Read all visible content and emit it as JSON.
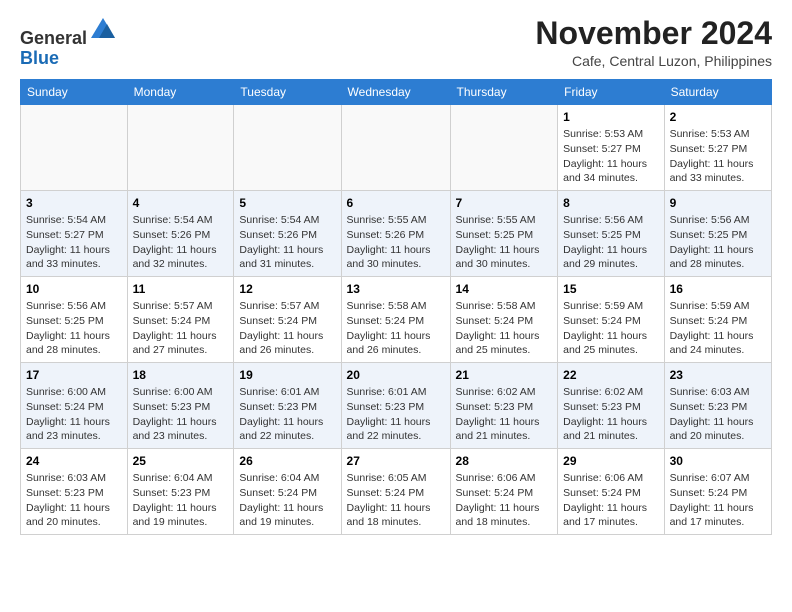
{
  "header": {
    "logo_general": "General",
    "logo_blue": "Blue",
    "month_title": "November 2024",
    "subtitle": "Cafe, Central Luzon, Philippines"
  },
  "days_of_week": [
    "Sunday",
    "Monday",
    "Tuesday",
    "Wednesday",
    "Thursday",
    "Friday",
    "Saturday"
  ],
  "weeks": [
    [
      {
        "day": "",
        "detail": ""
      },
      {
        "day": "",
        "detail": ""
      },
      {
        "day": "",
        "detail": ""
      },
      {
        "day": "",
        "detail": ""
      },
      {
        "day": "",
        "detail": ""
      },
      {
        "day": "1",
        "detail": "Sunrise: 5:53 AM\nSunset: 5:27 PM\nDaylight: 11 hours\nand 34 minutes."
      },
      {
        "day": "2",
        "detail": "Sunrise: 5:53 AM\nSunset: 5:27 PM\nDaylight: 11 hours\nand 33 minutes."
      }
    ],
    [
      {
        "day": "3",
        "detail": "Sunrise: 5:54 AM\nSunset: 5:27 PM\nDaylight: 11 hours\nand 33 minutes."
      },
      {
        "day": "4",
        "detail": "Sunrise: 5:54 AM\nSunset: 5:26 PM\nDaylight: 11 hours\nand 32 minutes."
      },
      {
        "day": "5",
        "detail": "Sunrise: 5:54 AM\nSunset: 5:26 PM\nDaylight: 11 hours\nand 31 minutes."
      },
      {
        "day": "6",
        "detail": "Sunrise: 5:55 AM\nSunset: 5:26 PM\nDaylight: 11 hours\nand 30 minutes."
      },
      {
        "day": "7",
        "detail": "Sunrise: 5:55 AM\nSunset: 5:25 PM\nDaylight: 11 hours\nand 30 minutes."
      },
      {
        "day": "8",
        "detail": "Sunrise: 5:56 AM\nSunset: 5:25 PM\nDaylight: 11 hours\nand 29 minutes."
      },
      {
        "day": "9",
        "detail": "Sunrise: 5:56 AM\nSunset: 5:25 PM\nDaylight: 11 hours\nand 28 minutes."
      }
    ],
    [
      {
        "day": "10",
        "detail": "Sunrise: 5:56 AM\nSunset: 5:25 PM\nDaylight: 11 hours\nand 28 minutes."
      },
      {
        "day": "11",
        "detail": "Sunrise: 5:57 AM\nSunset: 5:24 PM\nDaylight: 11 hours\nand 27 minutes."
      },
      {
        "day": "12",
        "detail": "Sunrise: 5:57 AM\nSunset: 5:24 PM\nDaylight: 11 hours\nand 26 minutes."
      },
      {
        "day": "13",
        "detail": "Sunrise: 5:58 AM\nSunset: 5:24 PM\nDaylight: 11 hours\nand 26 minutes."
      },
      {
        "day": "14",
        "detail": "Sunrise: 5:58 AM\nSunset: 5:24 PM\nDaylight: 11 hours\nand 25 minutes."
      },
      {
        "day": "15",
        "detail": "Sunrise: 5:59 AM\nSunset: 5:24 PM\nDaylight: 11 hours\nand 25 minutes."
      },
      {
        "day": "16",
        "detail": "Sunrise: 5:59 AM\nSunset: 5:24 PM\nDaylight: 11 hours\nand 24 minutes."
      }
    ],
    [
      {
        "day": "17",
        "detail": "Sunrise: 6:00 AM\nSunset: 5:24 PM\nDaylight: 11 hours\nand 23 minutes."
      },
      {
        "day": "18",
        "detail": "Sunrise: 6:00 AM\nSunset: 5:23 PM\nDaylight: 11 hours\nand 23 minutes."
      },
      {
        "day": "19",
        "detail": "Sunrise: 6:01 AM\nSunset: 5:23 PM\nDaylight: 11 hours\nand 22 minutes."
      },
      {
        "day": "20",
        "detail": "Sunrise: 6:01 AM\nSunset: 5:23 PM\nDaylight: 11 hours\nand 22 minutes."
      },
      {
        "day": "21",
        "detail": "Sunrise: 6:02 AM\nSunset: 5:23 PM\nDaylight: 11 hours\nand 21 minutes."
      },
      {
        "day": "22",
        "detail": "Sunrise: 6:02 AM\nSunset: 5:23 PM\nDaylight: 11 hours\nand 21 minutes."
      },
      {
        "day": "23",
        "detail": "Sunrise: 6:03 AM\nSunset: 5:23 PM\nDaylight: 11 hours\nand 20 minutes."
      }
    ],
    [
      {
        "day": "24",
        "detail": "Sunrise: 6:03 AM\nSunset: 5:23 PM\nDaylight: 11 hours\nand 20 minutes."
      },
      {
        "day": "25",
        "detail": "Sunrise: 6:04 AM\nSunset: 5:23 PM\nDaylight: 11 hours\nand 19 minutes."
      },
      {
        "day": "26",
        "detail": "Sunrise: 6:04 AM\nSunset: 5:24 PM\nDaylight: 11 hours\nand 19 minutes."
      },
      {
        "day": "27",
        "detail": "Sunrise: 6:05 AM\nSunset: 5:24 PM\nDaylight: 11 hours\nand 18 minutes."
      },
      {
        "day": "28",
        "detail": "Sunrise: 6:06 AM\nSunset: 5:24 PM\nDaylight: 11 hours\nand 18 minutes."
      },
      {
        "day": "29",
        "detail": "Sunrise: 6:06 AM\nSunset: 5:24 PM\nDaylight: 11 hours\nand 17 minutes."
      },
      {
        "day": "30",
        "detail": "Sunrise: 6:07 AM\nSunset: 5:24 PM\nDaylight: 11 hours\nand 17 minutes."
      }
    ]
  ]
}
